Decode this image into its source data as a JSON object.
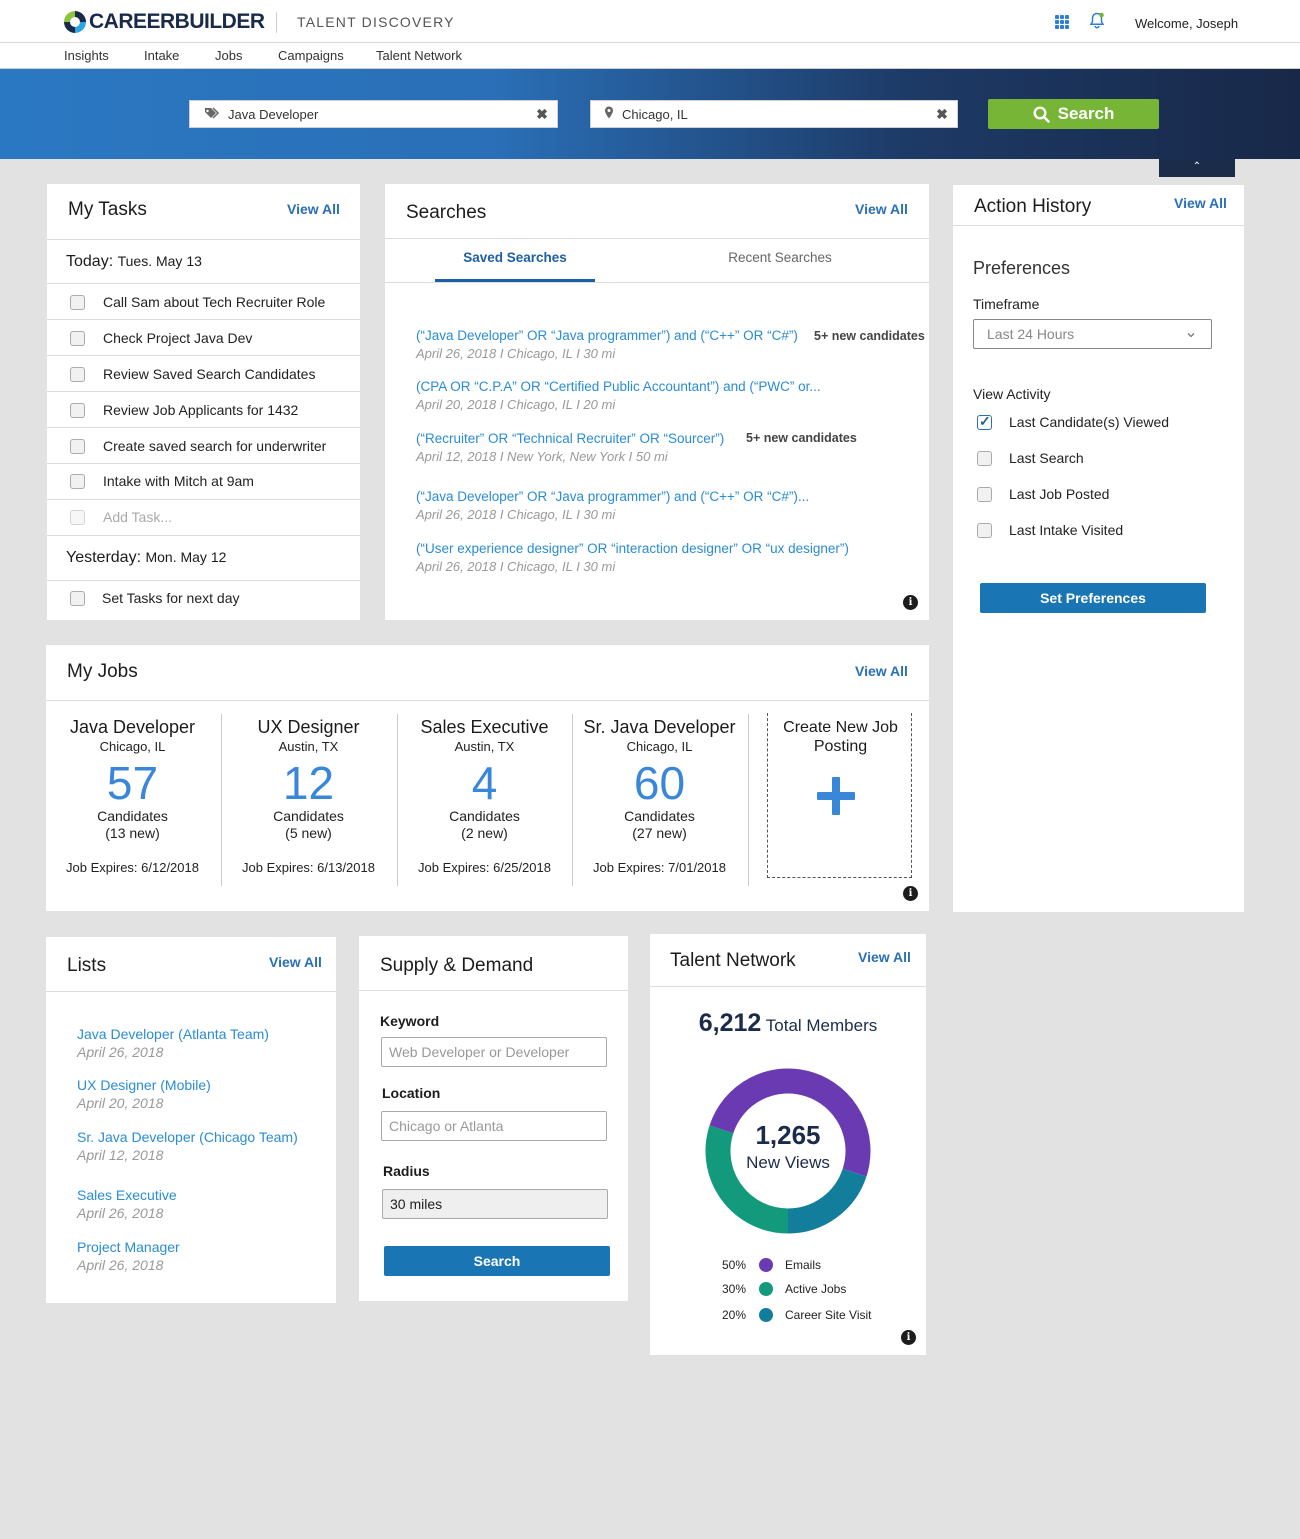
{
  "header": {
    "brand": "CAREERBUILDER",
    "product": "TALENT DISCOVERY",
    "welcome": "Welcome, Joseph"
  },
  "nav": [
    "Insights",
    "Intake",
    "Jobs",
    "Campaigns",
    "Talent Network"
  ],
  "hero": {
    "keyword_value": "Java Developer",
    "location_value": "Chicago, IL",
    "search_label": "Search"
  },
  "tasks": {
    "title": "My Tasks",
    "view_all": "View All",
    "today_label": "Today:",
    "today_date": "Tues. May 13",
    "today_items": [
      "Call Sam about Tech Recruiter Role",
      "Check Project Java Dev",
      "Review Saved Search Candidates",
      "Review Job Applicants for 1432",
      "Create saved search for underwriter",
      "Intake with Mitch at 9am"
    ],
    "add_placeholder": "Add Task...",
    "yesterday_label": "Yesterday:",
    "yesterday_date": "Mon. May 12",
    "yesterday_items": [
      "Set Tasks for next day"
    ]
  },
  "searches": {
    "title": "Searches",
    "view_all": "View All",
    "tabs": [
      "Saved Searches",
      "Recent Searches"
    ],
    "items": [
      {
        "query": "(“Java Developer” OR “Java programmer”) and (“C++” OR “C#”)",
        "meta": "April 26, 2018 I Chicago, IL I 30 mi",
        "badge": "5+ new candidates"
      },
      {
        "query": "(CPA OR “C.P.A” OR “Certified Public Accountant”) and (“PWC” or...",
        "meta": "April 20, 2018 I Chicago, IL I 20 mi",
        "badge": ""
      },
      {
        "query": "(“Recruiter” OR “Technical Recruiter” OR “Sourcer”)",
        "meta": "April 12, 2018 I New York, New York I 50 mi",
        "badge": "5+ new candidates"
      },
      {
        "query": "(“Java Developer” OR “Java programmer”) and (“C++” OR “C#”)...",
        "meta": "April 26, 2018 I Chicago, IL I 30 mi",
        "badge": ""
      },
      {
        "query": "(“User experience designer” OR “interaction designer” OR “ux designer”)",
        "meta": "April 26, 2018 I Chicago, IL I 30 mi",
        "badge": ""
      }
    ]
  },
  "action_history": {
    "title": "Action History",
    "view_all": "View All",
    "preferences": "Preferences",
    "timeframe_label": "Timeframe",
    "timeframe_value": "Last 24 Hours",
    "view_activity": "View Activity",
    "options": [
      {
        "label": "Last Candidate(s) Viewed",
        "checked": true
      },
      {
        "label": "Last Search",
        "checked": false
      },
      {
        "label": "Last Job Posted",
        "checked": false
      },
      {
        "label": "Last Intake Visited",
        "checked": false
      }
    ],
    "set_button": "Set Preferences"
  },
  "jobs": {
    "title": "My Jobs",
    "view_all": "View All",
    "items": [
      {
        "title": "Java Developer",
        "location": "Chicago, IL",
        "count": "57",
        "cand_label": "Candidates",
        "new": "(13 new)",
        "expires": "Job Expires: 6/12/2018"
      },
      {
        "title": "UX Designer",
        "location": "Austin, TX",
        "count": "12",
        "cand_label": "Candidates",
        "new": "(5 new)",
        "expires": "Job Expires: 6/13/2018"
      },
      {
        "title": "Sales Executive",
        "location": "Austin, TX",
        "count": "4",
        "cand_label": "Candidates",
        "new": "(2 new)",
        "expires": "Job Expires: 6/25/2018"
      },
      {
        "title": "Sr. Java Developer",
        "location": "Chicago, IL",
        "count": "60",
        "cand_label": "Candidates",
        "new": "(27 new)",
        "expires": "Job Expires: 7/01/2018"
      }
    ],
    "create_label": "Create New Job Posting"
  },
  "lists": {
    "title": "Lists",
    "view_all": "View All",
    "items": [
      {
        "name": "Java Developer (Atlanta Team)",
        "date": "April 26, 2018"
      },
      {
        "name": "UX Designer (Mobile)",
        "date": "April 20, 2018"
      },
      {
        "name": "Sr. Java Developer (Chicago Team)",
        "date": "April 12, 2018"
      },
      {
        "name": "Sales Executive",
        "date": "April 26, 2018"
      },
      {
        "name": "Project Manager",
        "date": "April 26, 2018"
      }
    ]
  },
  "supply_demand": {
    "title": "Supply & Demand",
    "keyword_label": "Keyword",
    "keyword_placeholder": "Web Developer or Developer",
    "location_label": "Location",
    "location_placeholder": "Chicago or Atlanta",
    "radius_label": "Radius",
    "radius_value": "30 miles",
    "search_button": "Search"
  },
  "talent_network": {
    "title": "Talent Network",
    "view_all": "View All",
    "total_number": "6,212",
    "total_label": "Total Members",
    "center_number": "1,265",
    "center_label": "New Views",
    "legend": [
      {
        "pct": "50%",
        "label": "Emails",
        "value": 50,
        "color": "#6a3ab2"
      },
      {
        "pct": "30%",
        "label": "Active Jobs",
        "value": 30,
        "color": "#139a7c"
      },
      {
        "pct": "20%",
        "label": "Career Site Visit",
        "value": 20,
        "color": "#137e9b"
      }
    ]
  },
  "colors": {
    "accent": "#2a6fb7",
    "green": "#76b535",
    "navy": "#1b2c4b"
  }
}
